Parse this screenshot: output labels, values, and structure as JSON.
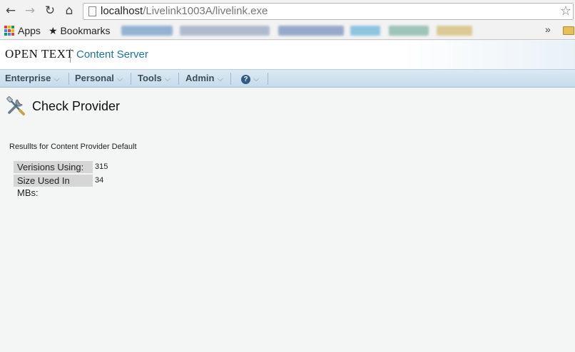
{
  "browser": {
    "url_host": "localhost",
    "url_path": "/Livelink1003A/livelink.exe",
    "back_icon": "←",
    "forward_icon": "→",
    "reload_icon": "↻",
    "home_icon": "⌂",
    "star_icon": "☆"
  },
  "bookmarks": {
    "apps_label": "Apps",
    "bookmarks_label": "Bookmarks",
    "bookmarks_icon": "★",
    "overflow_icon": "»"
  },
  "header": {
    "logo": "OPEN TEXT",
    "product": "Content Server"
  },
  "menu": {
    "items": [
      {
        "label": "Enterprise"
      },
      {
        "label": "Personal"
      },
      {
        "label": "Tools"
      },
      {
        "label": "Admin"
      }
    ],
    "caret": "⌵",
    "help_symbol": "?"
  },
  "page": {
    "title": "Check Provider",
    "results_caption": "Resullts for Content Provider Default",
    "rows": [
      {
        "label": "Verisions Using:",
        "value": "315"
      },
      {
        "label": "Size Used In MBs:",
        "value": "34"
      }
    ]
  }
}
